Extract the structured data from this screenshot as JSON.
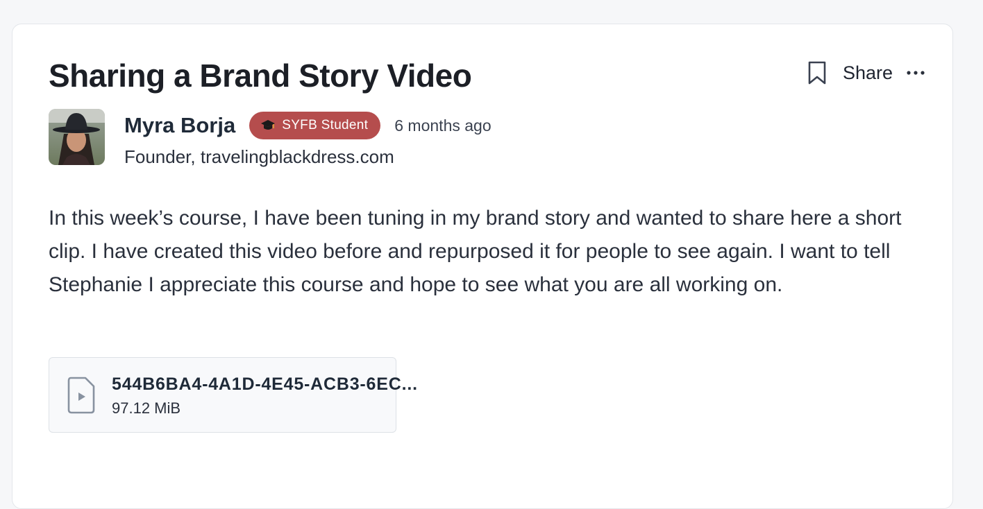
{
  "post": {
    "title": "Sharing a Brand Story Video",
    "body": "In this week’s course, I have been tuning in my brand story and wanted to share here a short clip. I have created this video before and repurposed it for people to see again. I want to tell Stephanie I appreciate this course and hope to see what you are all working on."
  },
  "actions": {
    "bookmark_icon": "bookmark-icon",
    "share_label": "Share",
    "more_icon": "more-horizontal-icon"
  },
  "author": {
    "name": "Myra Borja",
    "badge_label": "SYFB Student",
    "badge_icon": "graduation-cap-icon",
    "badge_color": "#b54d4d",
    "timestamp": "6 months ago",
    "role": "Founder, travelingblackdress.com"
  },
  "attachment": {
    "icon": "video-file-icon",
    "file_name": "544B6BA4-4A1D-4E45-ACB3-6EC...",
    "file_size": "97.12 MiB"
  }
}
